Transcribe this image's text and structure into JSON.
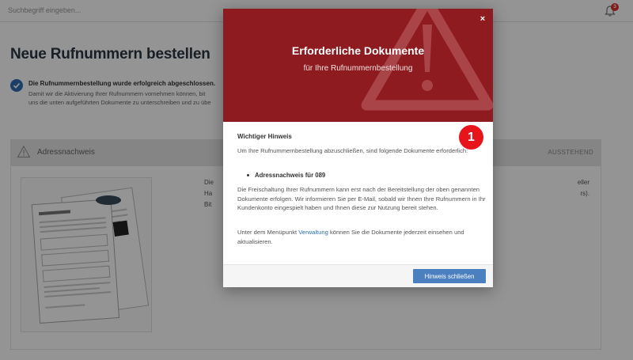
{
  "topbar": {
    "search_placeholder": "Suchbegriff eingeben...",
    "notification_count": "3"
  },
  "page": {
    "title": "Neue Rufnummern bestellen",
    "success_title": "Die Rufnummernbestellung wurde erfolgreich abgeschlossen.",
    "success_line1": "Damit wir die Aktivierung Ihrer Rufnummern vornehmen können, bit",
    "success_line2": "uns die unten aufgeführten Dokumente zu unterschreiben und zu übe"
  },
  "document_card": {
    "title": "Adressnachweis",
    "status": "AUSSTEHEND",
    "text_left_1": "Die",
    "text_left_2": "Ha",
    "text_left_3": "Bit",
    "text_right_1": "eller",
    "text_right_2": "rs)."
  },
  "modal": {
    "title": "Erforderliche Dokumente",
    "subtitle": "für Ihre Rufnummernbestellung",
    "close_icon": "×",
    "marker": "1",
    "hint_title": "Wichtiger Hinweis",
    "paragraph1": "Um Ihre Rufnummernbestellung abzuschließen, sind folgende Dokumente erforderlich:",
    "bullet": "Adressnachweis für 089",
    "paragraph2": "Die Freischaltung Ihrer Rufnummern kann erst nach der Bereitstellung der oben genannten Dokumente erfolgen. Wir informieren Sie per E-Mail, sobald wir Ihnen Ihre Rufnummern in Ihr Kundenkonto eingespielt haben und Ihnen diese zur Nutzung bereit stehen.",
    "paragraph3_before": "Unter dem Menüpunkt ",
    "paragraph3_link": "Verwaltung",
    "paragraph3_after": " können Sie die Dokumente jederzeit einsehen und aktualisieren.",
    "close_button": "Hinweis schließen"
  },
  "colors": {
    "modal_header": "#8e1b20",
    "primary_button": "#4a7fc0",
    "marker": "#e8141c",
    "link": "#2e6fb7"
  }
}
